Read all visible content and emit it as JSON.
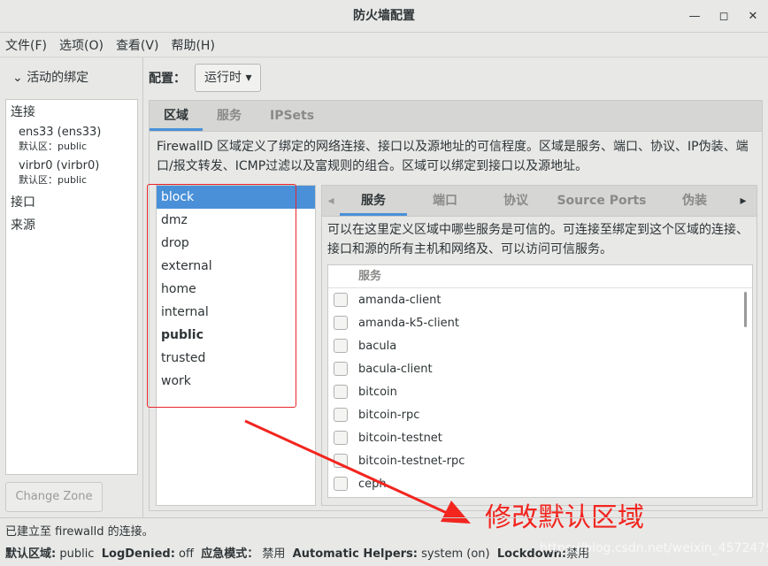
{
  "window": {
    "title": "防火墙配置",
    "min": "—",
    "max": "◻",
    "close": "✕"
  },
  "menu": [
    "文件(F)",
    "选项(O)",
    "查看(V)",
    "帮助(H)"
  ],
  "left": {
    "header": "活动的绑定",
    "sections": {
      "connections": "连接",
      "interfaces": "接口",
      "sources": "来源"
    },
    "connections": [
      {
        "name": "ens33 (ens33)",
        "zone_label": "默认区：",
        "zone": "public"
      },
      {
        "name": "virbr0 (virbr0)",
        "zone_label": "默认区：",
        "zone": "public"
      }
    ],
    "change_zone": "Change Zone"
  },
  "config": {
    "label": "配置：",
    "value": "运行时"
  },
  "tabs": [
    "区域",
    "服务",
    "IPSets"
  ],
  "zone_desc": "FirewallD 区域定义了绑定的网络连接、接口以及源地址的可信程度。区域是服务、端口、协议、IP伪装、端口/报文转发、ICMP过滤以及富规则的组合。区域可以绑定到接口以及源地址。",
  "zones": [
    "block",
    "dmz",
    "drop",
    "external",
    "home",
    "internal",
    "public",
    "trusted",
    "work"
  ],
  "selected_zone": "block",
  "default_zone": "public",
  "subtabs": [
    "服务",
    "端口",
    "协议",
    "Source Ports",
    "伪装"
  ],
  "services_desc": "可以在这里定义区域中哪些服务是可信的。可连接至绑定到这个区域的连接、接口和源的所有主机和网络及、可以访问可信服务。",
  "services_header": "服务",
  "services": [
    "amanda-client",
    "amanda-k5-client",
    "bacula",
    "bacula-client",
    "bitcoin",
    "bitcoin-rpc",
    "bitcoin-testnet",
    "bitcoin-testnet-rpc",
    "ceph"
  ],
  "status": {
    "line1": "已建立至 firewalld 的连接。",
    "default_zone_label": "默认区域:",
    "default_zone": "public",
    "logdenied_label": "LogDenied:",
    "logdenied": "off",
    "panic_label": "应急模式：",
    "panic": "禁用",
    "helpers_label": "Automatic Helpers:",
    "helpers": "system (on)",
    "lockdown_label": "Lockdown:",
    "lockdown": "禁用"
  },
  "annotation": {
    "text": "修改默认区域",
    "color": "#f2251f"
  },
  "watermark": "https://blog.csdn.net/weixin_45724795"
}
